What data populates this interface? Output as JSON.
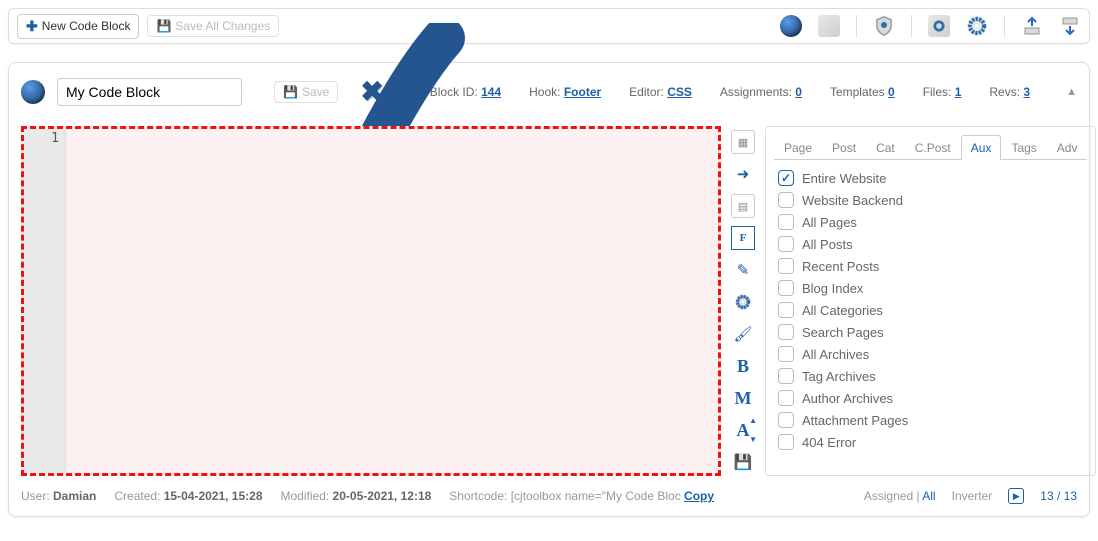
{
  "toolbar": {
    "new_block": "New Code Block",
    "save_all": "Save All Changes"
  },
  "header": {
    "name_value": "My Code Block",
    "save_label": "Save",
    "block_id_label": "Block ID:",
    "block_id": "144",
    "hook_label": "Hook:",
    "hook": "Footer",
    "editor_label": "Editor:",
    "editor": "CSS",
    "assignments_label": "Assignments:",
    "assignments": "0",
    "templates_label": "Templates",
    "templates": "0",
    "files_label": "Files:",
    "files": "1",
    "revs_label": "Revs:",
    "revs": "3"
  },
  "editor": {
    "line_number": "1"
  },
  "side_tools": {
    "bold": "B",
    "m": "M",
    "a": "A"
  },
  "tabs": [
    "Page",
    "Post",
    "Cat",
    "C.Post",
    "Aux",
    "Tags",
    "Adv"
  ],
  "active_tab": "Aux",
  "aux_items": [
    {
      "label": "Entire Website",
      "checked": true
    },
    {
      "label": "Website Backend",
      "checked": false
    },
    {
      "label": "All Pages",
      "checked": false
    },
    {
      "label": "All Posts",
      "checked": false
    },
    {
      "label": "Recent Posts",
      "checked": false
    },
    {
      "label": "Blog Index",
      "checked": false
    },
    {
      "label": "All Categories",
      "checked": false
    },
    {
      "label": "Search Pages",
      "checked": false
    },
    {
      "label": "All Archives",
      "checked": false
    },
    {
      "label": "Tag Archives",
      "checked": false
    },
    {
      "label": "Author Archives",
      "checked": false
    },
    {
      "label": "Attachment Pages",
      "checked": false
    },
    {
      "label": "404 Error",
      "checked": false
    }
  ],
  "footer": {
    "user_label": "User:",
    "user": "Damian",
    "created_label": "Created:",
    "created": "15-04-2021, 15:28",
    "modified_label": "Modified:",
    "modified": "20-05-2021, 12:18",
    "shortcode_label": "Shortcode:",
    "shortcode": "[cjtoolbox name=\"My Code Bloc",
    "copy": "Copy",
    "assigned": "Assigned",
    "all": "All",
    "inverter": "Inverter",
    "count": "13 / 13"
  }
}
